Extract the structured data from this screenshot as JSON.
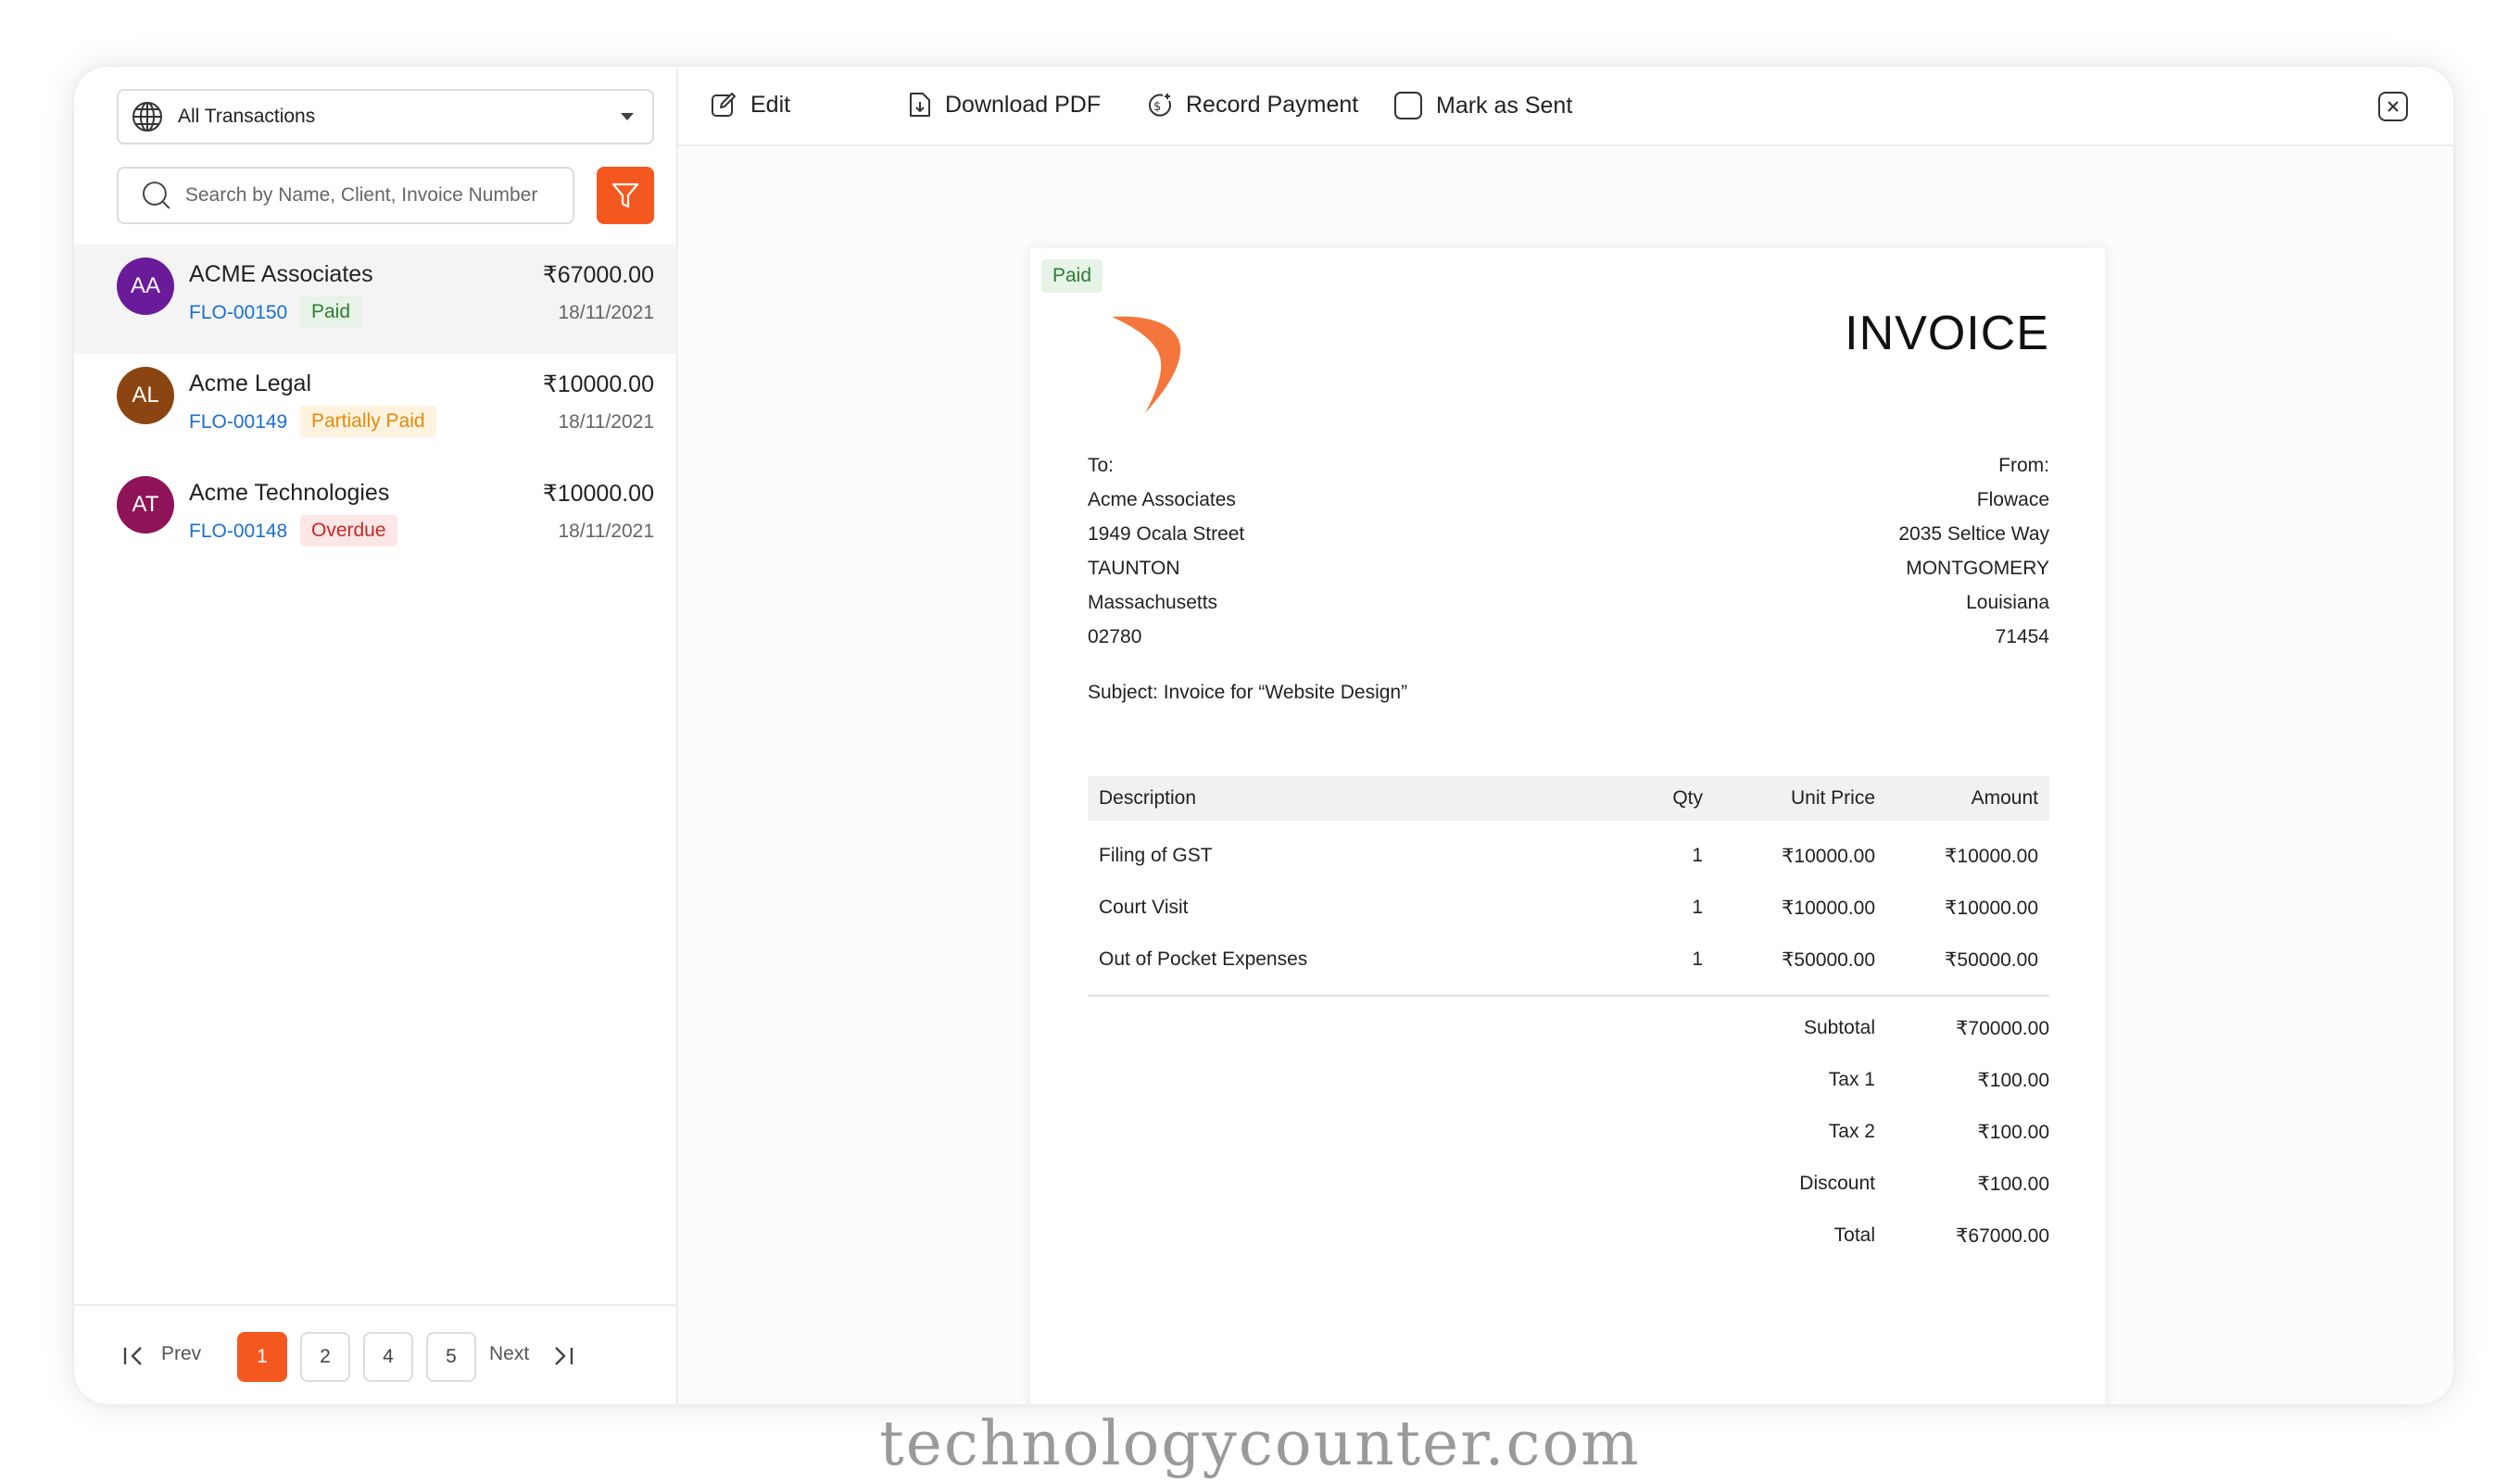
{
  "sidebar": {
    "filter_select": {
      "value": "All Transactions",
      "icon": "globe-icon"
    },
    "search": {
      "placeholder": "Search by Name, Client, Invoice Number"
    },
    "filter_button": {
      "icon": "filter-icon",
      "color": "#f4581f"
    },
    "transactions": [
      {
        "initials": "AA",
        "avatar_color": "#6a1b9a",
        "name": "ACME Associates",
        "amount": "₹67000.00",
        "number": "FLO-00150",
        "status": "Paid",
        "date": "18/11/2021",
        "selected": true
      },
      {
        "initials": "AL",
        "avatar_color": "#8b4513",
        "name": "Acme Legal",
        "amount": "₹10000.00",
        "number": "FLO-00149",
        "status": "Partially Paid",
        "date": "18/11/2021",
        "selected": false
      },
      {
        "initials": "AT",
        "avatar_color": "#8e1457",
        "name": "Acme Technologies",
        "amount": "₹10000.00",
        "number": "FLO-00148",
        "status": "Overdue",
        "date": "18/11/2021",
        "selected": false
      }
    ],
    "pagination": {
      "prev_label": "Prev",
      "next_label": "Next",
      "pages": [
        "1",
        "2",
        "4",
        "5"
      ],
      "current": "1"
    }
  },
  "toolbar": {
    "edit_label": "Edit",
    "download_label": "Download PDF",
    "record_payment_label": "Record Payment",
    "mark_sent_label": "Mark as Sent",
    "close_icon": "close-icon"
  },
  "invoice": {
    "status": "Paid",
    "title": "INVOICE",
    "to": {
      "label": "To:",
      "name": "Acme Associates",
      "street": "1949 Ocala Street",
      "city": "TAUNTON",
      "state": "Massachusetts",
      "zip": "02780"
    },
    "from": {
      "label": "From:",
      "name": "Flowace",
      "street": "2035 Seltice Way",
      "city": "MONTGOMERY",
      "state": "Louisiana",
      "zip": "71454"
    },
    "subject": "Subject: Invoice for “Website Design”",
    "columns": {
      "description": "Description",
      "qty": "Qty",
      "unit_price": "Unit Price",
      "amount": "Amount"
    },
    "items": [
      {
        "description": "Filing of GST",
        "qty": "1",
        "unit_price": "₹10000.00",
        "amount": "₹10000.00"
      },
      {
        "description": "Court Visit",
        "qty": "1",
        "unit_price": "₹10000.00",
        "amount": "₹10000.00"
      },
      {
        "description": "Out of Pocket Expenses",
        "qty": "1",
        "unit_price": "₹50000.00",
        "amount": "₹50000.00"
      }
    ],
    "totals": [
      {
        "label": "Subtotal",
        "value": "₹70000.00"
      },
      {
        "label": "Tax 1",
        "value": "₹100.00"
      },
      {
        "label": "Tax 2",
        "value": "₹100.00"
      },
      {
        "label": "Discount",
        "value": "₹100.00"
      },
      {
        "label": "Total",
        "value": "₹67000.00"
      }
    ]
  },
  "watermark": "technologycounter.com",
  "colors": {
    "accent": "#f4581f",
    "link": "#1a6fd1"
  }
}
